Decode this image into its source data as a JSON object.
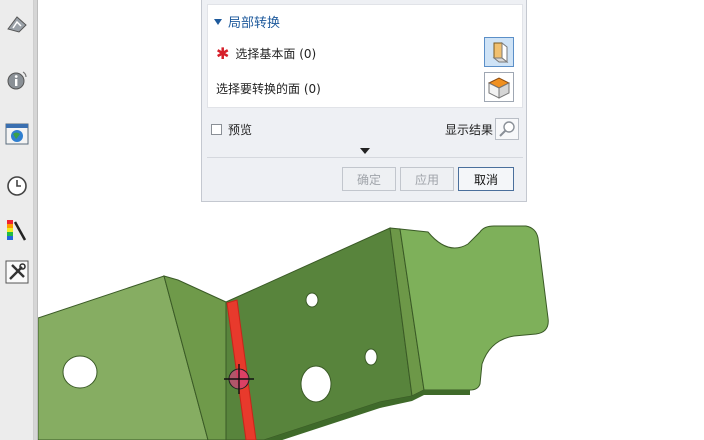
{
  "dialog": {
    "group_title": "局部转换",
    "select_base_label": "选择基本面 (0)",
    "select_convert_label": "选择要转换的面 (0)",
    "preview_label": "预览",
    "show_result_label": "显示结果",
    "buttons": {
      "ok": "确定",
      "apply": "应用",
      "cancel": "取消"
    }
  },
  "left_bar": {
    "icons": [
      "part-navigator-icon",
      "info-icon",
      "web-browser-icon",
      "history-icon",
      "palette-icon",
      "tools-icon"
    ]
  },
  "colors": {
    "part_green_light": "#7fa85a",
    "part_green_dark": "#55803a",
    "bend_highlight": "#e83a2c",
    "dialog_bg": "#eef0f4",
    "accent": "#1e5a9c"
  }
}
